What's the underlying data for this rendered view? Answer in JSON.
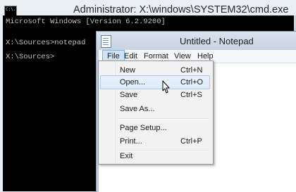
{
  "cmd": {
    "title": "Administrator: X:\\windows\\SYSTEM32\\cmd.exe",
    "icon_text": "C:\\.",
    "lines": [
      "Microsoft Windows [Version 6.2.9200]",
      "",
      "X:\\Sources>notepad",
      "",
      "X:\\Sources>"
    ]
  },
  "notepad": {
    "title": "Untitled - Notepad",
    "menus": [
      "File",
      "Edit",
      "Format",
      "View",
      "Help"
    ],
    "active_menu": "File"
  },
  "file_menu": {
    "items": [
      {
        "label": "New",
        "shortcut": "Ctrl+N"
      },
      {
        "label": "Open...",
        "shortcut": "Ctrl+O",
        "highlighted": true
      },
      {
        "label": "Save",
        "shortcut": "Ctrl+S"
      },
      {
        "label": "Save As...",
        "shortcut": ""
      },
      {
        "label": "Page Setup...",
        "shortcut": ""
      },
      {
        "label": "Print...",
        "shortcut": "Ctrl+P"
      },
      {
        "label": "Exit",
        "shortcut": ""
      }
    ]
  },
  "colors": {
    "console_bg": "#000000",
    "console_text": "#c0c0c0",
    "menu_highlight": "#dcebfa",
    "menu_highlight_border": "#aacbef"
  }
}
